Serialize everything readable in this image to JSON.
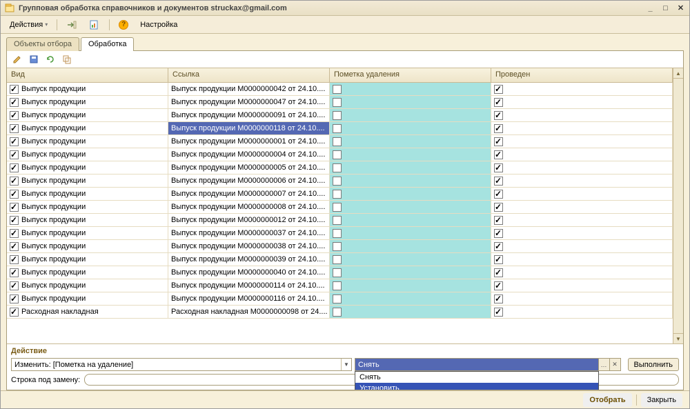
{
  "window": {
    "title": "Групповая обработка справочников и документов struckax@gmail.com"
  },
  "toolbar": {
    "actions": "Действия",
    "settings": "Настройка"
  },
  "tabs": {
    "t1": "Объекты отбора",
    "t2": "Обработка"
  },
  "grid": {
    "headers": {
      "vid": "Вид",
      "link": "Ссылка",
      "mark": "Пометка удаления",
      "prov": "Проведен"
    },
    "rows": [
      {
        "vid": "Выпуск продукции",
        "link": "Выпуск продукции М0000000042 от 24.10....",
        "sel": false
      },
      {
        "vid": "Выпуск продукции",
        "link": "Выпуск продукции М0000000047 от 24.10....",
        "sel": false
      },
      {
        "vid": "Выпуск продукции",
        "link": "Выпуск продукции М0000000091 от 24.10....",
        "sel": false
      },
      {
        "vid": "Выпуск продукции",
        "link": "Выпуск продукции М0000000118 от 24.10....",
        "sel": true
      },
      {
        "vid": "Выпуск продукции",
        "link": "Выпуск продукции М0000000001 от 24.10....",
        "sel": false
      },
      {
        "vid": "Выпуск продукции",
        "link": "Выпуск продукции М0000000004 от 24.10....",
        "sel": false
      },
      {
        "vid": "Выпуск продукции",
        "link": "Выпуск продукции М0000000005 от 24.10....",
        "sel": false
      },
      {
        "vid": "Выпуск продукции",
        "link": "Выпуск продукции М0000000006 от 24.10....",
        "sel": false
      },
      {
        "vid": "Выпуск продукции",
        "link": "Выпуск продукции М0000000007 от 24.10....",
        "sel": false
      },
      {
        "vid": "Выпуск продукции",
        "link": "Выпуск продукции М0000000008 от 24.10....",
        "sel": false
      },
      {
        "vid": "Выпуск продукции",
        "link": "Выпуск продукции М0000000012 от 24.10....",
        "sel": false
      },
      {
        "vid": "Выпуск продукции",
        "link": "Выпуск продукции М0000000037 от 24.10....",
        "sel": false
      },
      {
        "vid": "Выпуск продукции",
        "link": "Выпуск продукции М0000000038 от 24.10....",
        "sel": false
      },
      {
        "vid": "Выпуск продукции",
        "link": "Выпуск продукции М0000000039 от 24.10....",
        "sel": false
      },
      {
        "vid": "Выпуск продукции",
        "link": "Выпуск продукции М0000000040 от 24.10....",
        "sel": false
      },
      {
        "vid": "Выпуск продукции",
        "link": "Выпуск продукции М0000000114 от 24.10....",
        "sel": false
      },
      {
        "vid": "Выпуск продукции",
        "link": "Выпуск продукции М0000000116 от 24.10....",
        "sel": false
      },
      {
        "vid": "Расходная накладная",
        "link": "Расходная накладная М0000000098 от 24....",
        "sel": false
      }
    ]
  },
  "action": {
    "legend": "Действие",
    "combo1": "Изменить: [Пометка на удаление]",
    "combo2": "Снять",
    "opt1": "Снять",
    "opt2": "Установить",
    "run": "Выполнить",
    "repl_label": "Строка под замену:"
  },
  "footer": {
    "select": "Отобрать",
    "close": "Закрыть"
  }
}
